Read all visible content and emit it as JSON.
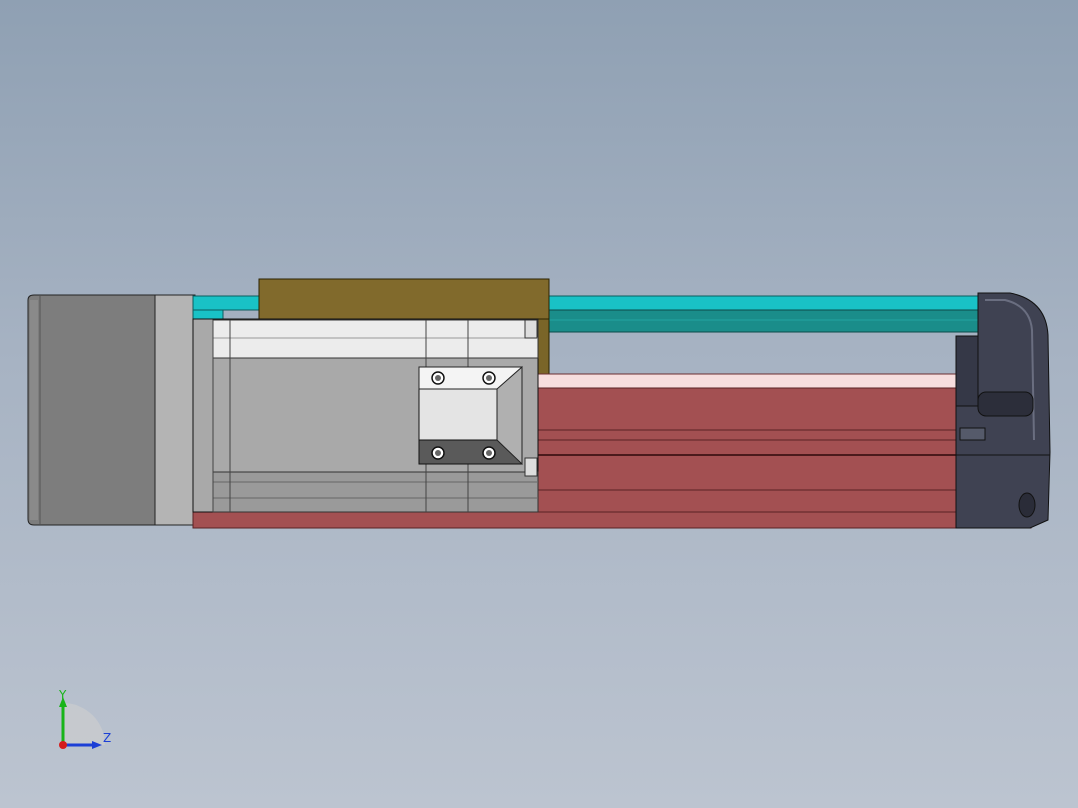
{
  "viewport": {
    "background_top": "#8fa0b3",
    "background_bottom": "#bcc4d0"
  },
  "model": {
    "colors": {
      "motor_dark": "#7d7d7d",
      "motor_flange": "#b4b4b4",
      "housing": "#a9a9a9",
      "rail_cyan": "#19c2c6",
      "rail_teal": "#1a8d8a",
      "carriage_olive": "#816a2c",
      "profile_red": "#a35052",
      "profile_pink": "#f7dede",
      "end_cap": "#3f4252"
    },
    "icons": [
      "bolt-icon",
      "bolt-icon",
      "bolt-icon",
      "bolt-icon"
    ]
  },
  "triad": {
    "y_label": "Y",
    "z_label": "Z",
    "y_color": "#18b418",
    "z_color": "#1c3fd6",
    "x_color": "#d41c1c"
  }
}
